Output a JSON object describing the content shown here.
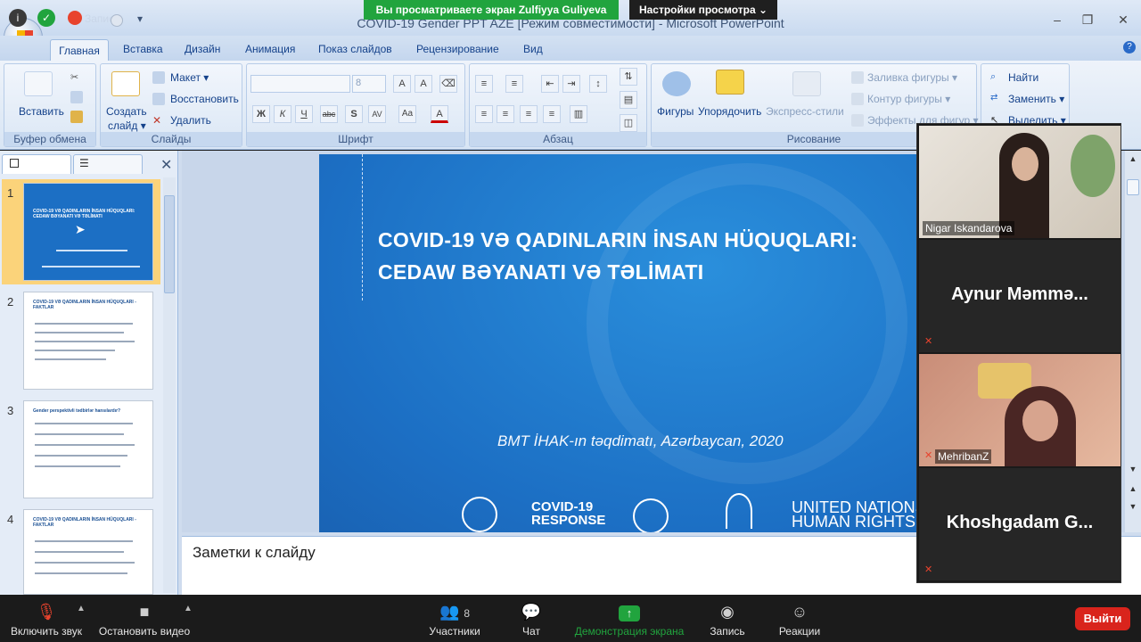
{
  "zoom_top": {
    "share_banner": "Вы просматриваете экран Zulfiyya Guliyeva",
    "view_options": "Настройки просмотра ⌄"
  },
  "window": {
    "title": "COVID-19 Gender PPT AZE [Режим совместимости] - Microsoft PowerPoint",
    "qat_text": "Запись"
  },
  "ribbon": {
    "tabs": [
      "Главная",
      "Вставка",
      "Дизайн",
      "Анимация",
      "Показ слайдов",
      "Рецензирование",
      "Вид"
    ],
    "groups": {
      "clipboard": {
        "label": "Буфер обмена",
        "paste": "Вставить"
      },
      "slides": {
        "label": "Слайды",
        "new_slide_1": "Создать",
        "new_slide_2": "слайд ▾",
        "layout": "Макет ▾",
        "reset": "Восстановить",
        "delete": "Удалить"
      },
      "font": {
        "label": "Шрифт",
        "size": "8"
      },
      "paragraph": {
        "label": "Абзац"
      },
      "drawing": {
        "label": "Рисование",
        "shapes": "Фигуры",
        "arrange": "Упорядочить",
        "quick_styles": "Экспресс-стили",
        "fill": "Заливка фигуры ▾",
        "outline": "Контур фигуры ▾",
        "effects": "Эффекты для фигур ▾"
      },
      "editing": {
        "find": "Найти",
        "replace": "Заменить ▾",
        "select": "Выделить ▾"
      }
    }
  },
  "thumbnails": [
    {
      "num": "1",
      "title": "COVID-19 VƏ QADINLARIN İNSAN HÜQUQLARI: CEDAW BƏYANATI VƏ TƏLİMATI",
      "selected": true
    },
    {
      "num": "2",
      "title": "COVID-19 VƏ QADINLARIN İNSAN HÜQUQLARI - FAKTLAR",
      "selected": false
    },
    {
      "num": "3",
      "title": "Gender perspektivli tədbirlər hansılardır?",
      "selected": false
    },
    {
      "num": "4",
      "title": "COVID-19 VƏ QADINLARIN İNSAN HÜQUQLARI - FAKTLAR",
      "selected": false
    }
  ],
  "slide": {
    "title_line1": "COVID-19 VƏ QADINLARIN İNSAN HÜQUQLARI:",
    "title_line2": "CEDAW BƏYANATI VƏ TƏLİMATI",
    "subtitle": "BMT İHAK-ın təqdimatı, Azərbaycan, 2020",
    "logo_covid_1": "COVID-19",
    "logo_covid_2": "RESPONSE",
    "logo_un_1": "UNITED NATIONS",
    "logo_un_2": "HUMAN RIGHTS"
  },
  "notes": {
    "placeholder": "Заметки к слайду"
  },
  "participants": [
    {
      "name": "Nigar Iskandarova",
      "type": "video",
      "muted": false
    },
    {
      "name": "Aynur Məmmə...",
      "type": "name",
      "muted": true
    },
    {
      "name": "MehribanZ",
      "type": "video",
      "muted": true
    },
    {
      "name": "Khoshgadam G...",
      "type": "name",
      "muted": true
    }
  ],
  "toolbar": {
    "mute": "Включить звук",
    "video": "Остановить видео",
    "participants": "Участники",
    "participants_count": "8",
    "chat": "Чат",
    "share": "Демонстрация экрана",
    "record": "Запись",
    "reactions": "Реакции",
    "leave": "Выйти"
  },
  "colors": {
    "zoom_green": "#21a43e",
    "leave_red": "#d9241c",
    "slide_blue": "#1c6fc4",
    "ribbon_text": "#15428b"
  }
}
